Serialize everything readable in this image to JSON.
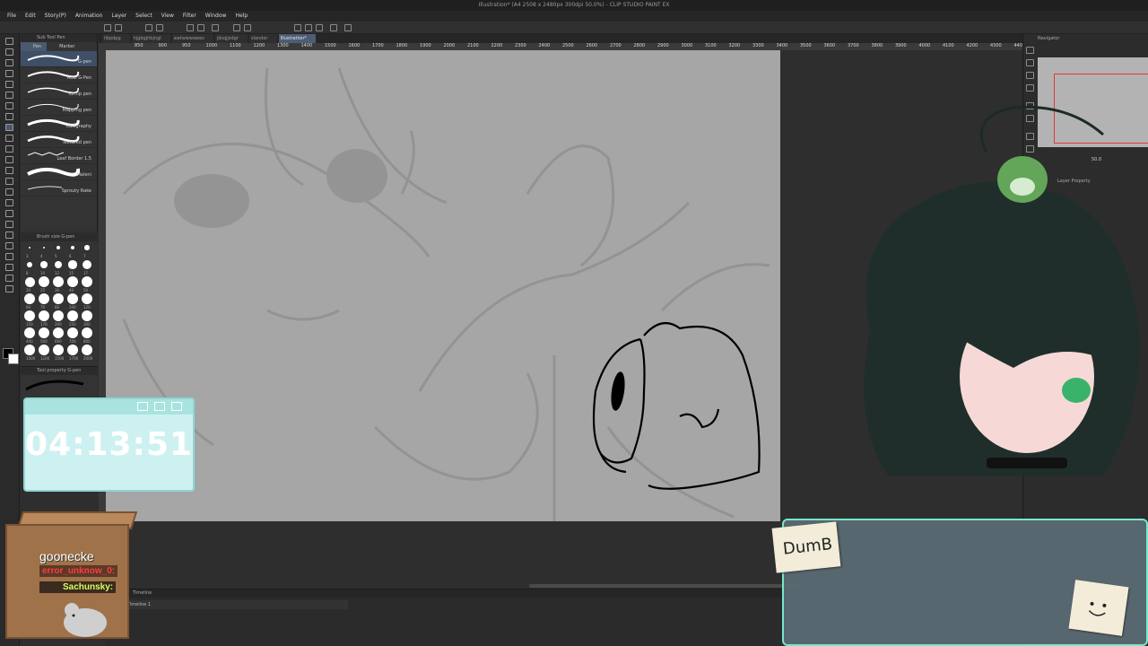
{
  "window": {
    "title": "Illustration* (A4 2508 x 2480px 300dpi 50.0%) - CLIP STUDIO PAINT EX"
  },
  "menu": [
    "File",
    "Edit",
    "Story(P)",
    "Animation",
    "Layer",
    "Select",
    "View",
    "Filter",
    "Window",
    "Help"
  ],
  "subtool": {
    "header": "Sub Tool Pen",
    "tabs": [
      "Pen",
      "Marker"
    ],
    "brushes": [
      "G-pen",
      "Real G-Pen",
      "Turnip pen",
      "Mapping pen",
      "Calligraphy",
      "Textured pen",
      "Leaf Border 1.5",
      "Maleni",
      "Sprouty Rake"
    ]
  },
  "brush_size": {
    "header": "Brush size G-pen",
    "sizes": [
      "3",
      "4",
      "5",
      "6",
      "7",
      "8",
      "10",
      "12",
      "15",
      "17",
      "20",
      "25",
      "30",
      "40",
      "50",
      "60",
      "70",
      "80",
      "100",
      "120",
      "150",
      "170",
      "200",
      "250",
      "300",
      "400",
      "500",
      "600",
      "700",
      "800",
      "1000",
      "1200",
      "1500",
      "1700",
      "2000"
    ]
  },
  "tool_property": {
    "header": "Tool property G-pen"
  },
  "doc_tabs": [
    "ilbpdpg",
    "hjgbgjhbjngl",
    "awtwwwawes",
    "jdsqjjsdgr",
    "slander",
    "Illustration*"
  ],
  "ruler": [
    "850",
    "900",
    "950",
    "1000",
    "1100",
    "1200",
    "1300",
    "1400",
    "1500",
    "1600",
    "1700",
    "1800",
    "1900",
    "2000",
    "2100",
    "2200",
    "2300",
    "2400",
    "2500",
    "2600",
    "2700",
    "2800",
    "2900",
    "3000",
    "3100",
    "3200",
    "3300",
    "3400",
    "3500",
    "3600",
    "3700",
    "3800",
    "3900",
    "4000",
    "4100",
    "4200",
    "4300",
    "4400",
    "4500"
  ],
  "navigator": {
    "header": "Navigator",
    "zoom": "50.0"
  },
  "layer_property": {
    "header": "Layer Property"
  },
  "timeline": {
    "header": "Timeline",
    "track": "Timeline 1"
  },
  "timer": {
    "value": "04:13:51"
  },
  "chat": {
    "channel": "goonecke",
    "error_user": "error_unknow_0:",
    "user": "Sachunsky:"
  },
  "stickers": {
    "note": "DumB"
  },
  "colors": {
    "canvas": "#a6a6a6",
    "timer_bg": "#cdf1f1",
    "timer_border": "#8fd6d2",
    "accent_tab": "#4c5d74",
    "nav_selection": "#e23a3a"
  }
}
